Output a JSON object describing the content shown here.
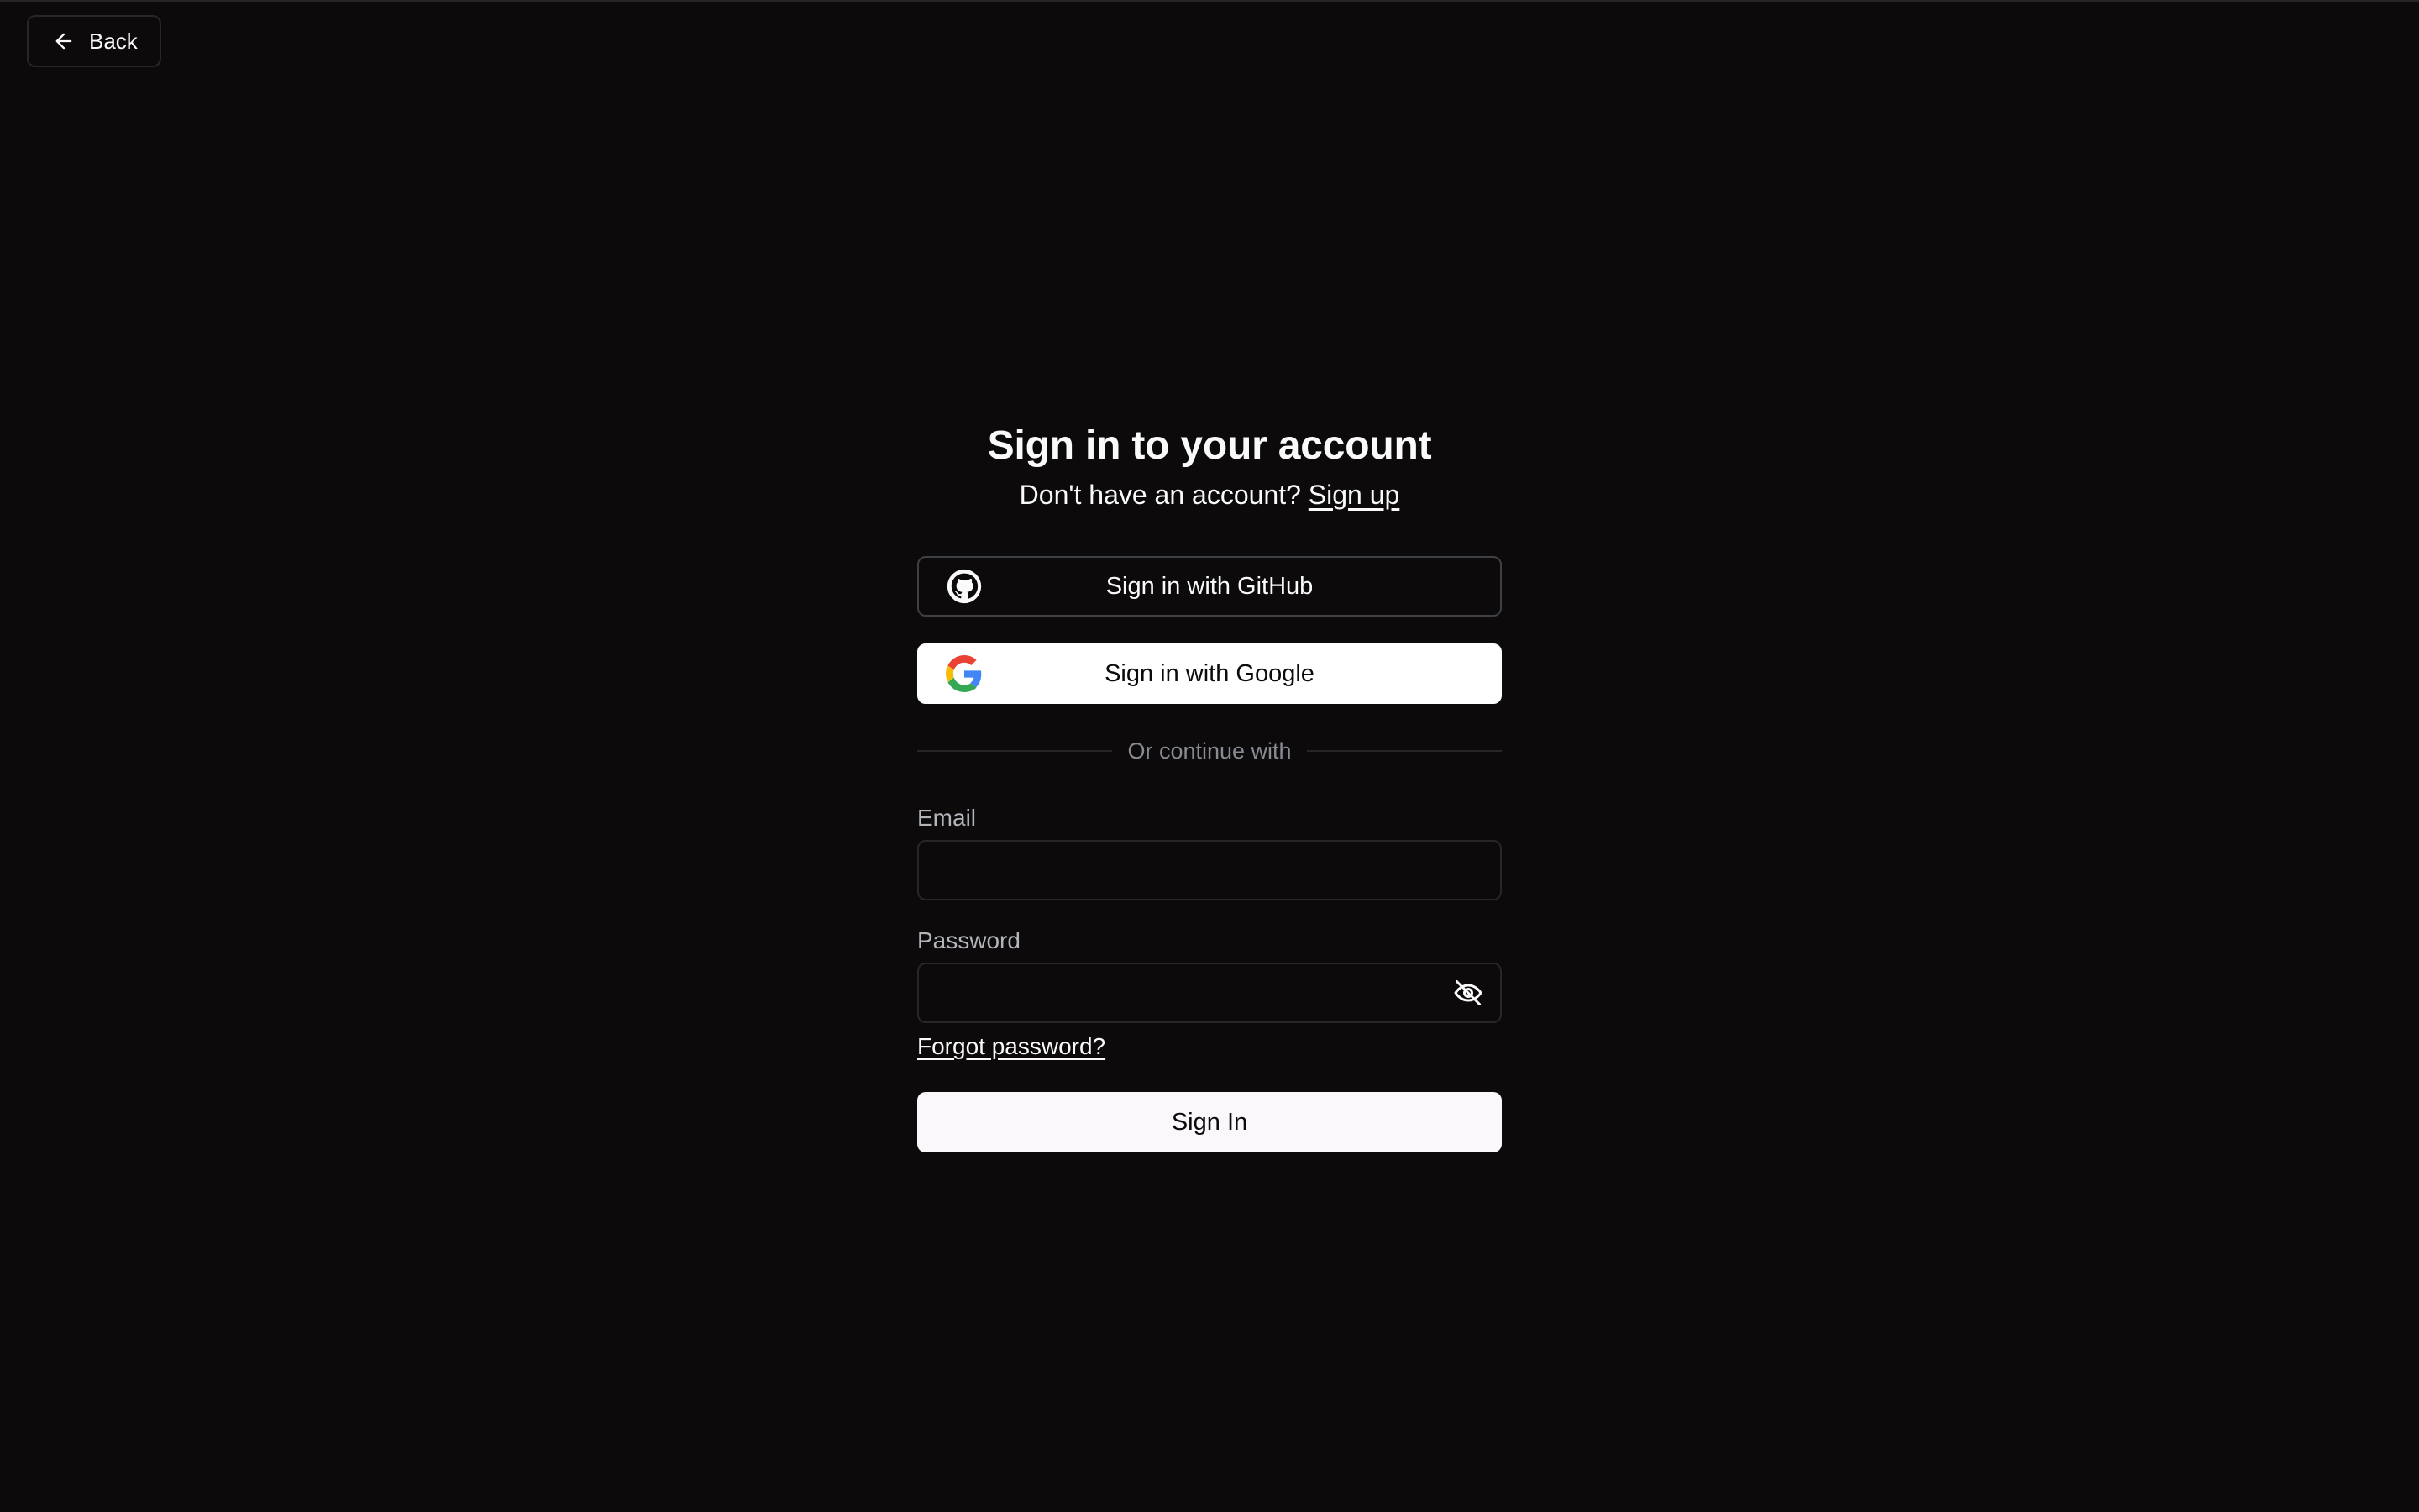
{
  "header": {
    "back_label": "Back",
    "back_icon": "arrow-left-icon"
  },
  "auth": {
    "title": "Sign in to your account",
    "subtitle_prefix": "Don't have an account?",
    "signup_link": "Sign up",
    "github_label": "Sign in with GitHub",
    "github_icon": "github-icon",
    "google_label": "Sign in with Google",
    "google_icon": "google-icon",
    "divider_text": "Or continue with",
    "email_label": "Email",
    "email_value": "",
    "password_label": "Password",
    "password_value": "",
    "password_toggle_icon": "eye-off-icon",
    "forgot_link": "Forgot password?",
    "submit_label": "Sign In"
  },
  "colors": {
    "background": "#0c0a0b",
    "foreground": "#fafafa",
    "border": "#27272a",
    "muted": "#8a8a93",
    "primary_button": "#faf8fa"
  }
}
